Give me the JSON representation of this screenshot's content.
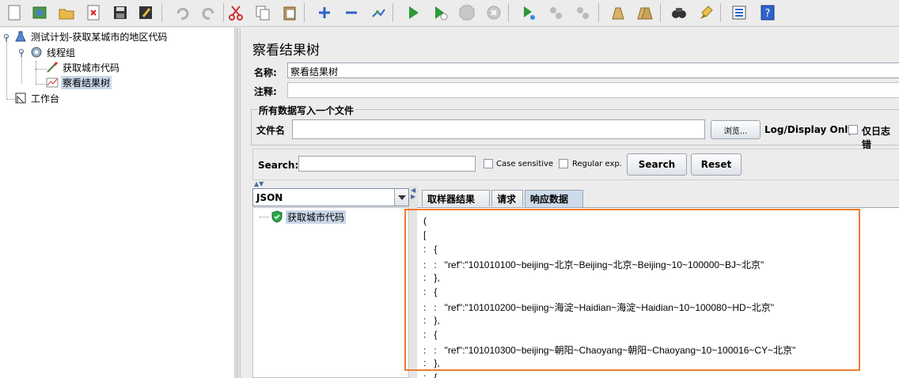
{
  "toolbar": {
    "buttons": [
      "new-icon",
      "templates-icon",
      "open-icon",
      "close-icon",
      "save-icon",
      "save-as-icon",
      "undo-icon",
      "redo-icon",
      "cut-icon",
      "copy-icon",
      "paste-icon",
      "expand-icon",
      "collapse-icon",
      "toggle-icon",
      "start-icon",
      "start-no-pause-icon",
      "stop-icon",
      "shutdown-icon",
      "remote-start-icon",
      "remote-stop-icon",
      "remote-shutdown-icon",
      "clear-icon",
      "clear-all-icon",
      "search-icon",
      "reset-search-icon",
      "function-helper-icon",
      "help-icon"
    ]
  },
  "tree": {
    "test_plan": "测试计划-获取某城市的地区代码",
    "thread_group": "线程组",
    "sampler": "获取城市代码",
    "listener": "察看结果树",
    "workbench": "工作台"
  },
  "panel": {
    "title": "察看结果树",
    "name_label": "名称:",
    "name_value": "察看结果树",
    "comment_label": "注释:",
    "comment_value": "",
    "file_group_title": "所有数据写入一个文件",
    "filename_label": "文件名",
    "filename_value": "",
    "browse_button": "浏览...",
    "log_display_label": "Log/Display Only:",
    "errors_only_label": "仅日志错"
  },
  "search": {
    "label": "Search:",
    "value": "",
    "case_sensitive": "Case sensitive",
    "regular_exp": "Regular exp.",
    "search_button": "Search",
    "reset_button": "Reset"
  },
  "results": {
    "renderer": "JSON",
    "sample_item": "获取城市代码",
    "tabs": [
      "取样器结果",
      "请求",
      "响应数据"
    ],
    "active_tab": "响应数据",
    "response_lines": [
      "(",
      "[",
      ":   {",
      ":   :   \"ref\":\"101010100~beijing~北京~Beijing~北京~Beijing~10~100000~BJ~北京\"",
      ":   },",
      ":   {",
      ":   :   \"ref\":\"101010200~beijing~海淀~Haidian~海淀~Haidian~10~100080~HD~北京\"",
      ":   },",
      ":   {",
      ":   :   \"ref\":\"101010300~beijing~朝阳~Chaoyang~朝阳~Chaoyang~10~100016~CY~北京\"",
      ":   },",
      ":   {"
    ]
  },
  "colors": {
    "highlight": "#ed7d31",
    "selection": "#c9d7e8",
    "active_tab": "#cddbeb"
  }
}
